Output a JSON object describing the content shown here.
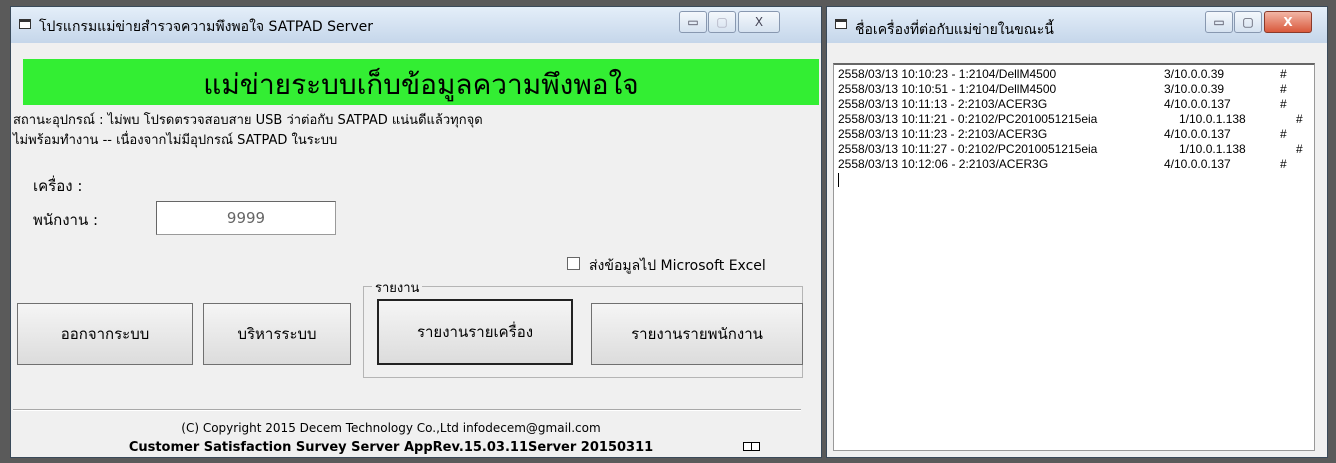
{
  "main_window": {
    "title": "โปรแกรมแม่ข่ายสำรวจความพึงพอใจ SATPAD Server",
    "banner": "แม่ข่ายระบบเก็บข้อมูลความพึงพอใจ",
    "status_line_1": "สถานะอุปกรณ์ : ไม่พบ  โปรดตรวจสอบสาย USB ว่าต่อกับ SATPAD แน่นดีแล้วทุกจุด",
    "status_line_2": "ไม่พร้อมทำงาน  -- เนื่องจากไม่มีอุปกรณ์ SATPAD ในระบบ",
    "machine_label": "เครื่อง :",
    "employee_label": "พนักงาน :",
    "employee_value": "9999",
    "excel_checkbox_label": "ส่งข้อมูลไป Microsoft Excel",
    "excel_checked": false,
    "report_group_label": "รายงาน",
    "buttons": {
      "logout": "ออกจากระบบ",
      "admin": "บริหารระบบ",
      "report_by_machine": "รายงานรายเครื่อง",
      "report_by_employee": "รายงานรายพนักงาน"
    },
    "copyright": "(C) Copyright 2015 Decem Technology Co.,Ltd  infodecem@gmail.com",
    "version": "Customer Satisfaction Survey Server AppRev.15.03.11Server 20150311"
  },
  "connections_window": {
    "title": "ชื่อเครื่องที่ต่อกับแม่ข่ายในขณะนี้",
    "rows": [
      {
        "entry": "2558/03/13 10:10:23 - 1:2104/DellM4500",
        "addr": "3/10.0.0.39",
        "mark": "#"
      },
      {
        "entry": "2558/03/13 10:10:51 - 1:2104/DellM4500",
        "addr": "3/10.0.0.39",
        "mark": "#"
      },
      {
        "entry": "2558/03/13 10:11:13 - 2:2103/ACER3G",
        "addr": "4/10.0.0.137",
        "mark": "#"
      },
      {
        "entry": "2558/03/13 10:11:21 - 0:2102/PC2010051215eia",
        "addr": "1/10.0.1.138",
        "mark": "#"
      },
      {
        "entry": "2558/03/13 10:11:23 - 2:2103/ACER3G",
        "addr": "4/10.0.0.137",
        "mark": "#"
      },
      {
        "entry": "2558/03/13 10:11:27 - 0:2102/PC2010051215eia",
        "addr": "1/10.0.1.138",
        "mark": "#"
      },
      {
        "entry": "2558/03/13 10:12:06 - 2:2103/ACER3G",
        "addr": "4/10.0.0.137",
        "mark": "#"
      }
    ]
  },
  "controls": {
    "minimize": "▭",
    "maximize": "▢",
    "close": "X"
  }
}
